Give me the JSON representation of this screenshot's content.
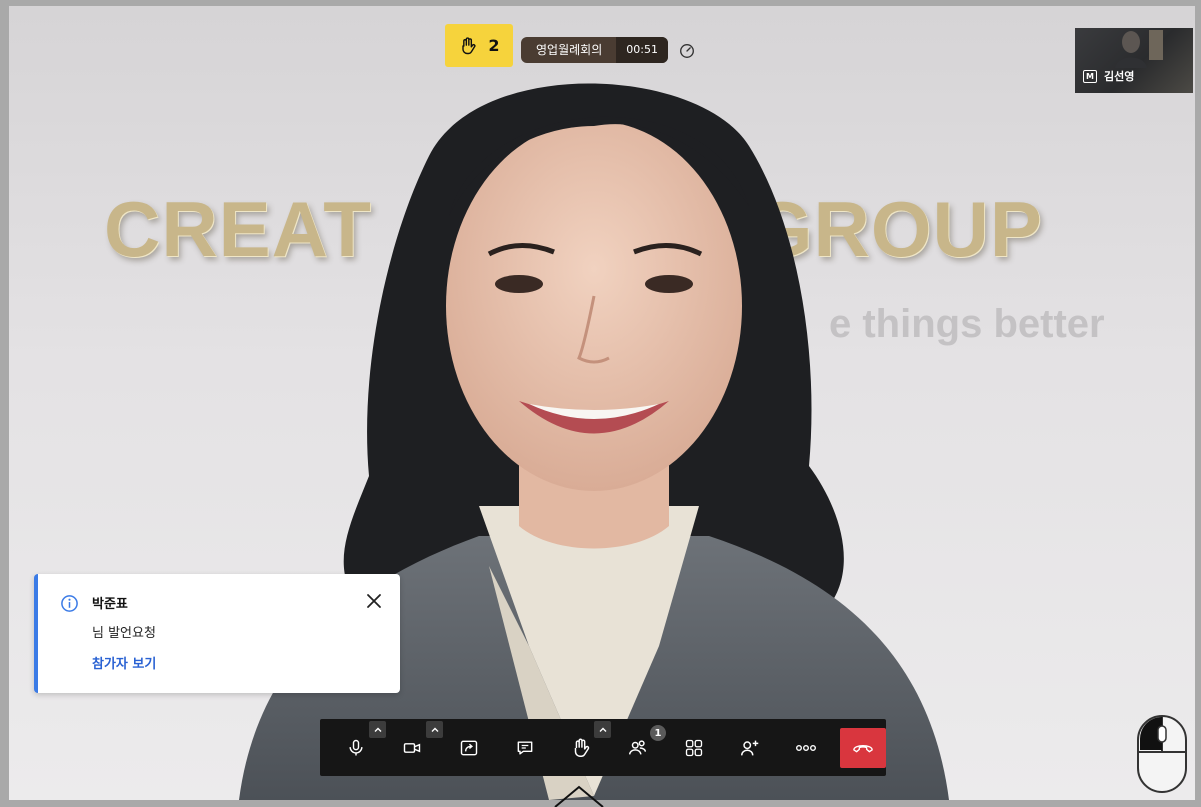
{
  "background_slide": {
    "title": "CREAT",
    "title_right": "N GROUP",
    "subtitle": "e things better"
  },
  "top_bar": {
    "raised_hands_count": "2",
    "meeting_name": "영업월례회의",
    "elapsed_time": "00:51"
  },
  "self_view": {
    "host_badge": "M",
    "participant_name": "김선영"
  },
  "notification": {
    "participant_name": "박준표",
    "message": "님 발언요청",
    "link_label": "참가자 보기"
  },
  "toolbar": {
    "participants_badge": "1",
    "buttons": [
      "microphone",
      "camera",
      "share-screen",
      "chat",
      "raise-hand",
      "participants",
      "layout",
      "invite",
      "more",
      "end-call"
    ]
  },
  "colors": {
    "hand_badge": "#f6d33c",
    "end_call": "#d9363e",
    "link": "#2a62d3",
    "toast_accent": "#3b7be6"
  }
}
